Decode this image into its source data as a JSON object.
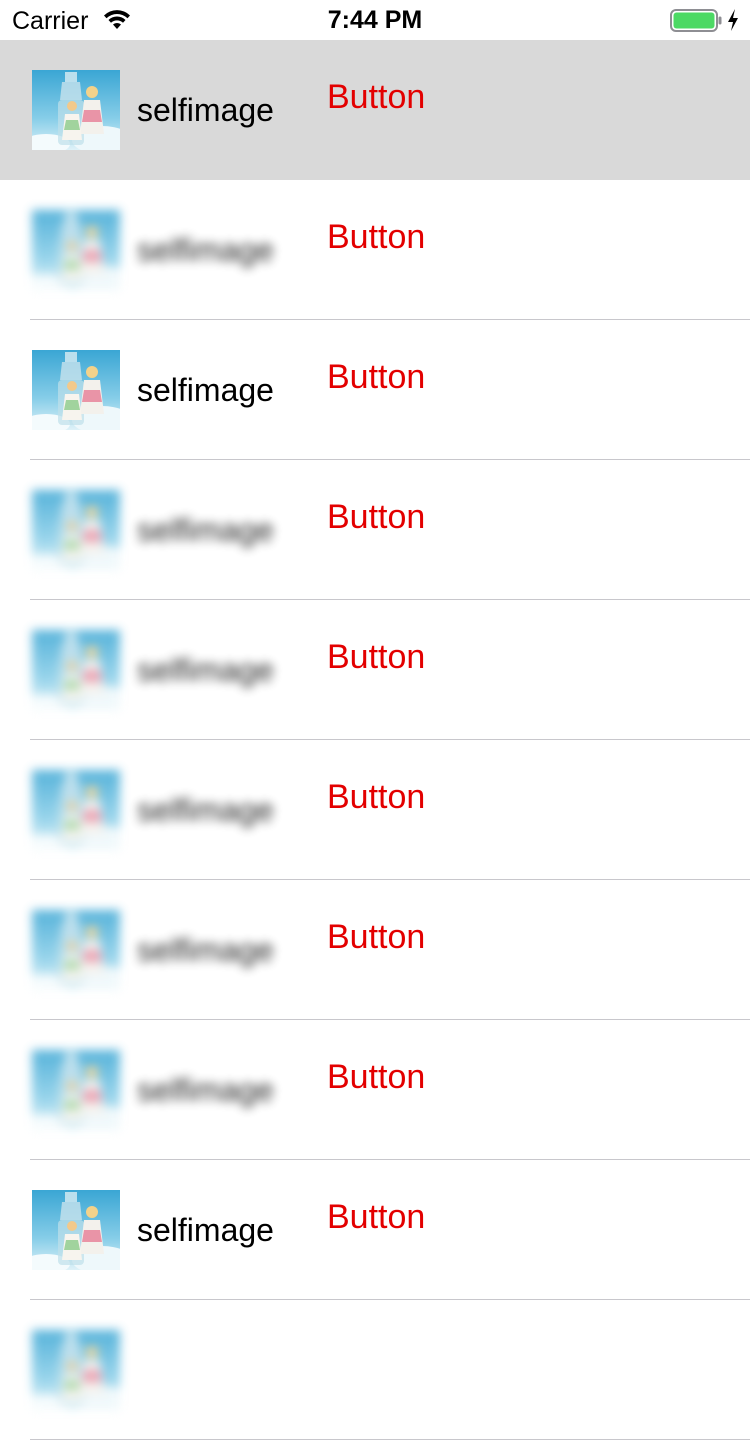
{
  "status_bar": {
    "carrier": "Carrier",
    "time": "7:44 PM",
    "icons": [
      "wifi-icon",
      "battery-icon",
      "charging-icon"
    ],
    "battery_color": "#4cd964"
  },
  "colors": {
    "button": "#e30000",
    "selected_row": "#d9d9d9",
    "separator": "#c8c7cc"
  },
  "rows": [
    {
      "label": "selfimage",
      "button": "Button",
      "selected": true,
      "blurred": false
    },
    {
      "label": "selfimage",
      "button": "Button",
      "selected": false,
      "blurred": true
    },
    {
      "label": "selfimage",
      "button": "Button",
      "selected": false,
      "blurred": false
    },
    {
      "label": "selfimage",
      "button": "Button",
      "selected": false,
      "blurred": true
    },
    {
      "label": "selfimage",
      "button": "Button",
      "selected": false,
      "blurred": true
    },
    {
      "label": "selfimage",
      "button": "Button",
      "selected": false,
      "blurred": true
    },
    {
      "label": "selfimage",
      "button": "Button",
      "selected": false,
      "blurred": true
    },
    {
      "label": "selfimage",
      "button": "Button",
      "selected": false,
      "blurred": true
    },
    {
      "label": "selfimage",
      "button": "Button",
      "selected": false,
      "blurred": false
    },
    {
      "label": "",
      "button": "",
      "selected": false,
      "blurred": true
    }
  ]
}
